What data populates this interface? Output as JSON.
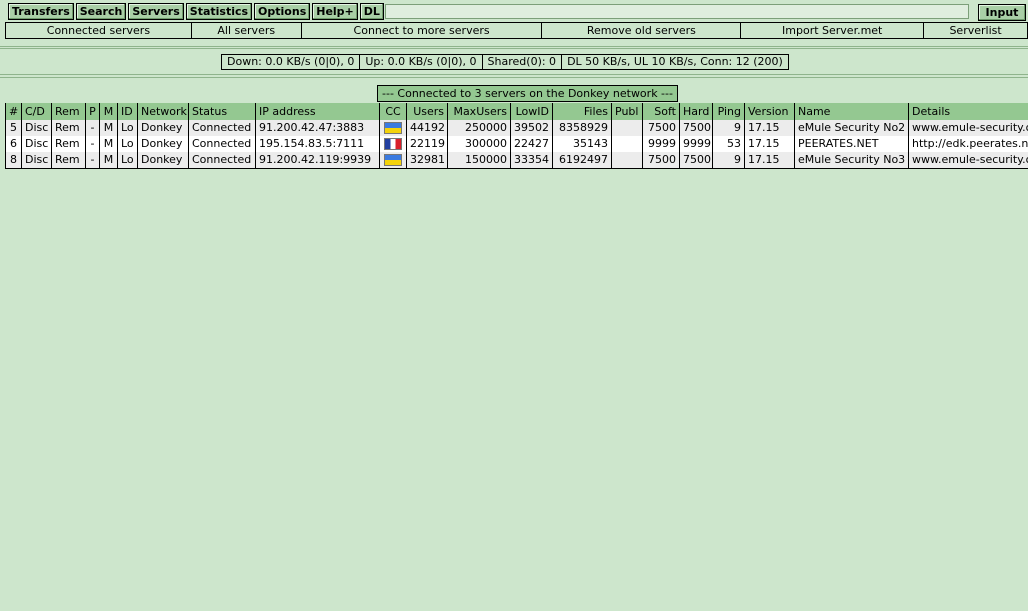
{
  "menu": {
    "transfers": "Transfers",
    "search": "Search",
    "servers": "Servers",
    "statistics": "Statistics",
    "options": "Options",
    "help": "Help+",
    "dl": "DL",
    "input_button": "Input",
    "command_value": ""
  },
  "submenu": {
    "connected_servers": "Connected servers",
    "all_servers": "All servers",
    "connect_more": "Connect to more servers",
    "remove_old": "Remove old servers",
    "import_servermet": "Import Server.met",
    "serverlist": "Serverlist"
  },
  "status": {
    "down": "Down: 0.0 KB/s (0|0), 0",
    "up": "Up: 0.0 KB/s (0|0), 0",
    "shared": "Shared(0): 0",
    "limits": "DL 50 KB/s, UL 10 KB/s, Conn: 12 (200)"
  },
  "caption": "--- Connected to 3 servers on the Donkey network ---",
  "table": {
    "headers": {
      "num": "#",
      "cd": "C/D",
      "rem": "Rem",
      "p": "P",
      "m": "M",
      "id": "ID",
      "network": "Network",
      "status": "Status",
      "ip": "IP address",
      "cc": "CC",
      "users": "Users",
      "maxusers": "MaxUsers",
      "lowid": "LowID",
      "files": "Files",
      "publ": "Publ",
      "soft": "Soft",
      "hard": "Hard",
      "ping": "Ping",
      "version": "Version",
      "name": "Name",
      "details": "Details"
    },
    "rows": [
      {
        "num": "5",
        "cd": "Disc",
        "rem": "Rem",
        "p": "-",
        "m": "M",
        "id": "Lo",
        "network": "Donkey",
        "status": "Connected",
        "ip": "91.200.42.47:3883",
        "flag": "ukraine-flag-icon",
        "users": "44192",
        "maxusers": "250000",
        "lowid": "39502",
        "files": "8358929",
        "publ": "",
        "soft": "7500",
        "hard": "7500",
        "ping": "9",
        "version": "17.15",
        "name": "eMule Security No2",
        "details": "www.emule-security.org"
      },
      {
        "num": "6",
        "cd": "Disc",
        "rem": "Rem",
        "p": "-",
        "m": "M",
        "id": "Lo",
        "network": "Donkey",
        "status": "Connected",
        "ip": "195.154.83.5:7111",
        "flag": "france-flag-icon",
        "users": "22119",
        "maxusers": "300000",
        "lowid": "22427",
        "files": "35143",
        "publ": "",
        "soft": "9999",
        "hard": "9999",
        "ping": "53",
        "version": "17.15",
        "name": "PEERATES.NET",
        "details": "http://edk.peerates.net"
      },
      {
        "num": "8",
        "cd": "Disc",
        "rem": "Rem",
        "p": "-",
        "m": "M",
        "id": "Lo",
        "network": "Donkey",
        "status": "Connected",
        "ip": "91.200.42.119:9939",
        "flag": "ukraine-flag-icon",
        "users": "32981",
        "maxusers": "150000",
        "lowid": "33354",
        "files": "6192497",
        "publ": "",
        "soft": "7500",
        "hard": "7500",
        "ping": "9",
        "version": "17.15",
        "name": "eMule Security No3",
        "details": "www.emule-security.org"
      }
    ]
  },
  "colors": {
    "background": "#cde6cc",
    "header": "#94c891",
    "button": "#a9cfa6"
  }
}
